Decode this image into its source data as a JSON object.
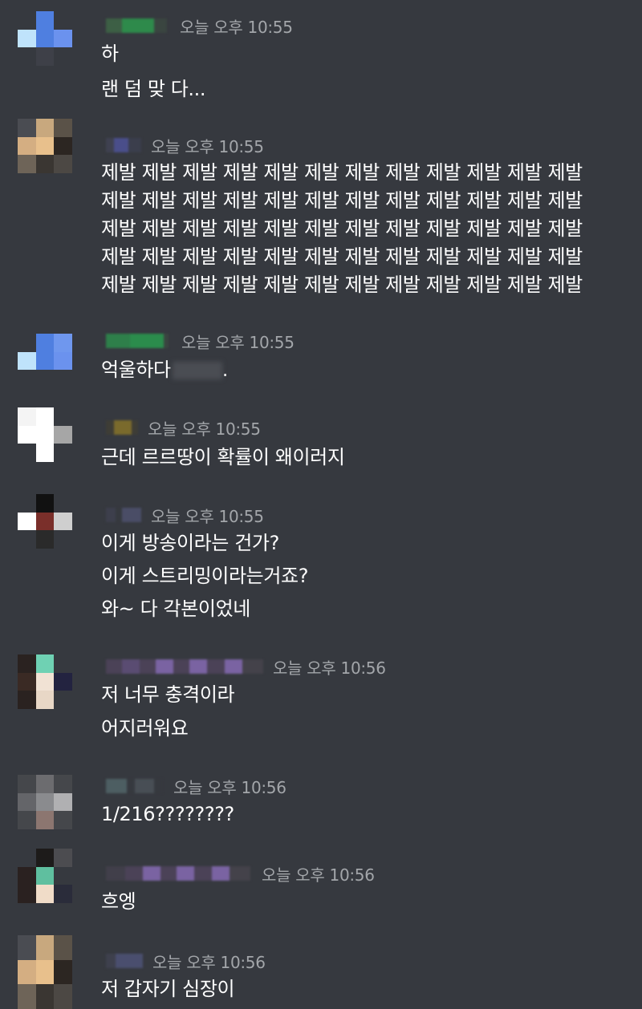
{
  "messages": [
    {
      "timestamp": "오늘 오후 10:55",
      "lines": [
        "하",
        "랜 덤 맞 다..."
      ]
    },
    {
      "timestamp": "오늘 오후 10:55",
      "lines": [
        "제발 제발 제발 제발 제발 제발 제발 제발 제발 제발 제발 제발",
        "제발 제발 제발 제발 제발 제발 제발 제발 제발 제발 제발 제발",
        "제발 제발 제발 제발 제발 제발 제발 제발 제발 제발 제발 제발",
        "제발 제발 제발 제발 제발 제발 제발 제발 제발 제발 제발 제발",
        "제발 제발 제발 제발 제발 제발 제발 제발 제발 제발 제발 제발"
      ]
    },
    {
      "timestamp": "오늘 오후 10:55",
      "lines": [
        "억울하다"
      ],
      "trail": "."
    },
    {
      "timestamp": "오늘 오후 10:55",
      "lines": [
        "근데 르르땅이 확률이 왜이러지"
      ]
    },
    {
      "timestamp": "오늘 오후 10:55",
      "lines": [
        "이게 방송이라는 건가?",
        "이게 스트리밍이라는거죠?",
        "와~ 다 각본이었네"
      ]
    },
    {
      "timestamp": "오늘 오후 10:56",
      "lines": [
        "저 너무 충격이라",
        "어지러워요"
      ]
    },
    {
      "timestamp": "오늘 오후 10:56",
      "lines": [
        "1/216????????"
      ]
    },
    {
      "timestamp": "오늘 오후 10:56",
      "lines": [
        "흐엥"
      ]
    },
    {
      "timestamp": "오늘 오후 10:56",
      "lines": [
        "저 갑자기 심장이"
      ]
    }
  ]
}
